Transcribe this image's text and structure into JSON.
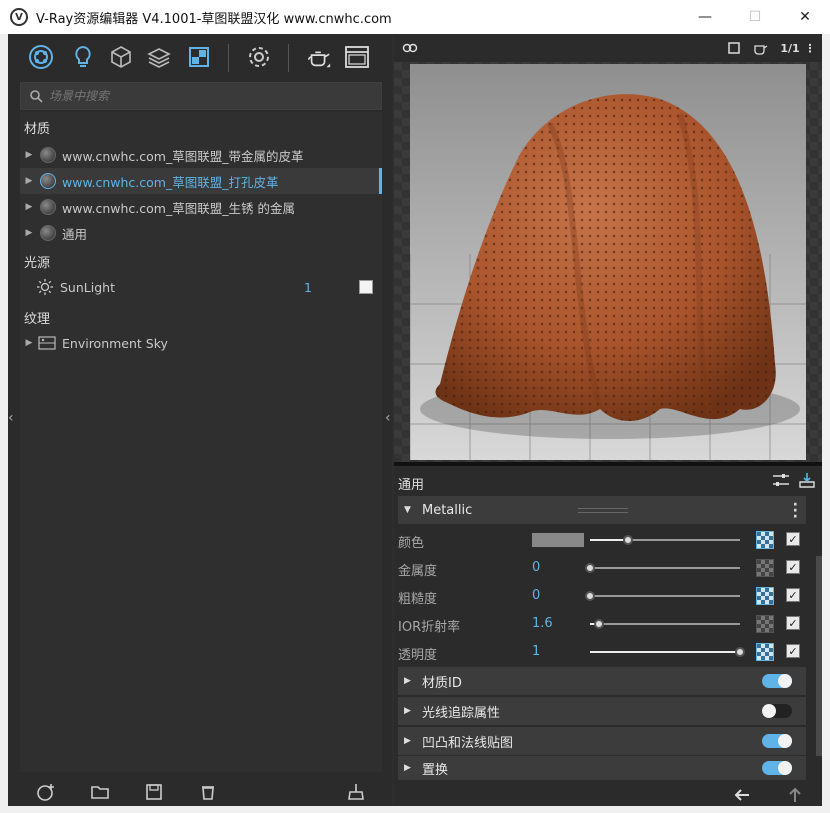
{
  "window": {
    "title": "V-Ray资源编辑器 V4.1001-草图联盟汉化 www.cnwhc.com",
    "app_icon": "vray-logo-icon",
    "minimize": "—",
    "maximize": "☐",
    "close": "✕"
  },
  "toolbar": {
    "icons": [
      "materials-icon",
      "lights-icon",
      "geometry-icon",
      "textures-icon",
      "render-elements-icon",
      "settings-icon",
      "render-teapot-icon",
      "frame-buffer-icon"
    ]
  },
  "search": {
    "placeholder": "场景中搜索"
  },
  "tree": {
    "materials_title": "材质",
    "materials": [
      {
        "label": "www.cnwhc.com_草图联盟_带金属的皮革",
        "selected": false
      },
      {
        "label": "www.cnwhc.com_草图联盟_打孔皮革",
        "selected": true
      },
      {
        "label": "www.cnwhc.com_草图联盟_生锈 的金属",
        "selected": false
      },
      {
        "label": "通用",
        "selected": false
      }
    ],
    "lights_title": "光源",
    "lights": [
      {
        "label": "SunLight",
        "count": "1",
        "swatch_color": "#f4f4f4"
      }
    ],
    "textures_title": "纹理",
    "textures": [
      {
        "label": "Environment Sky"
      }
    ]
  },
  "preview": {
    "ratio_label": "1/1",
    "accent_color": "#5fb3e6"
  },
  "properties": {
    "header": "通用",
    "metallic_group": "Metallic",
    "rows": [
      {
        "label": "颜色",
        "value": "",
        "fill": 0.25,
        "map_active": true,
        "checked": true
      },
      {
        "label": "金属度",
        "value": "0",
        "fill": 0.0,
        "map_active": false,
        "checked": true
      },
      {
        "label": "粗糙度",
        "value": "0",
        "fill": 0.0,
        "map_active": true,
        "checked": true
      },
      {
        "label": "IOR折射率",
        "value": "1.6",
        "fill": 0.06,
        "map_active": false,
        "checked": true
      },
      {
        "label": "透明度",
        "value": "1",
        "fill": 1.0,
        "map_active": true,
        "checked": true
      }
    ],
    "groups": [
      {
        "label": "材质ID",
        "on": true
      },
      {
        "label": "光线追踪属性",
        "on": false
      },
      {
        "label": "凹凸和法线贴图",
        "on": true
      },
      {
        "label": "置换",
        "on": true
      }
    ]
  }
}
